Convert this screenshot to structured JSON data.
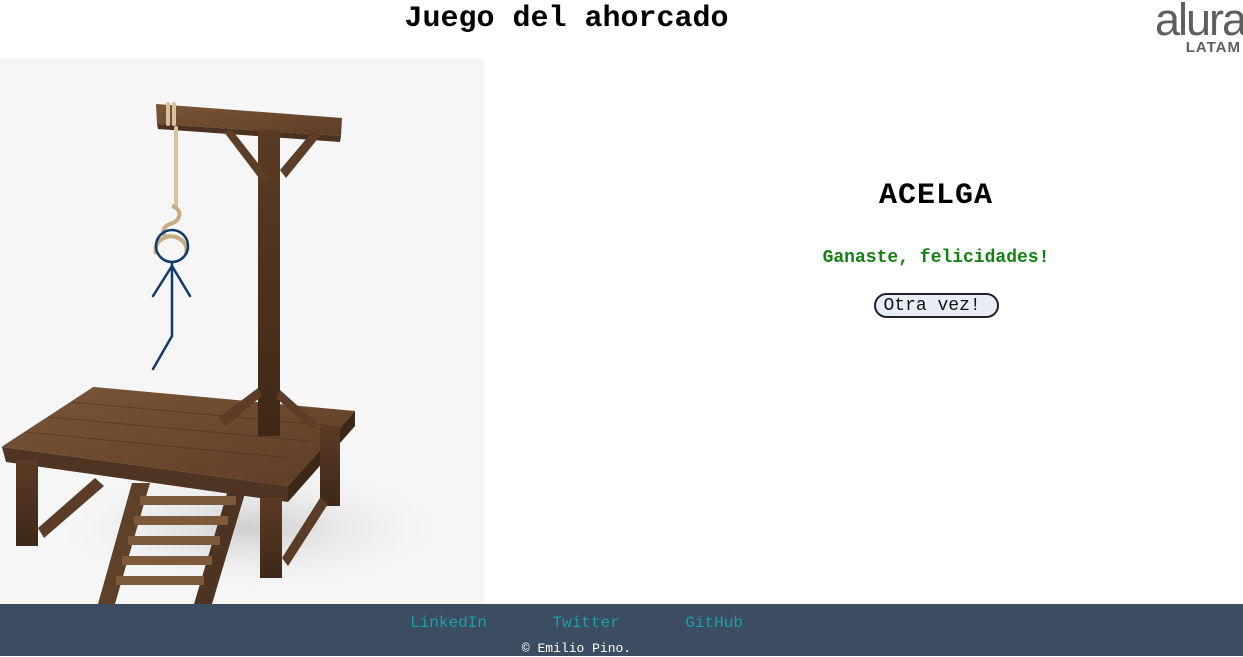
{
  "header": {
    "title": "Juego del ahorcado",
    "logo_word": "alura",
    "logo_sub": "LATAM"
  },
  "game": {
    "word": "ACELGA",
    "message": "Ganaste, felicidades!",
    "again_label": "Otra vez!"
  },
  "footer": {
    "links": [
      {
        "label": "LinkedIn"
      },
      {
        "label": "Twitter"
      },
      {
        "label": "GitHub"
      }
    ],
    "copyright": "© Emilio Pino."
  },
  "colors": {
    "footer_bg": "#3c4c61",
    "link": "#1aa0a8",
    "win_message": "#138013",
    "figure_stroke": "#123a6b",
    "wood": "#6b4a30"
  },
  "icons": {
    "gallows": "gallows-illustration",
    "figure": "stick-figure"
  }
}
